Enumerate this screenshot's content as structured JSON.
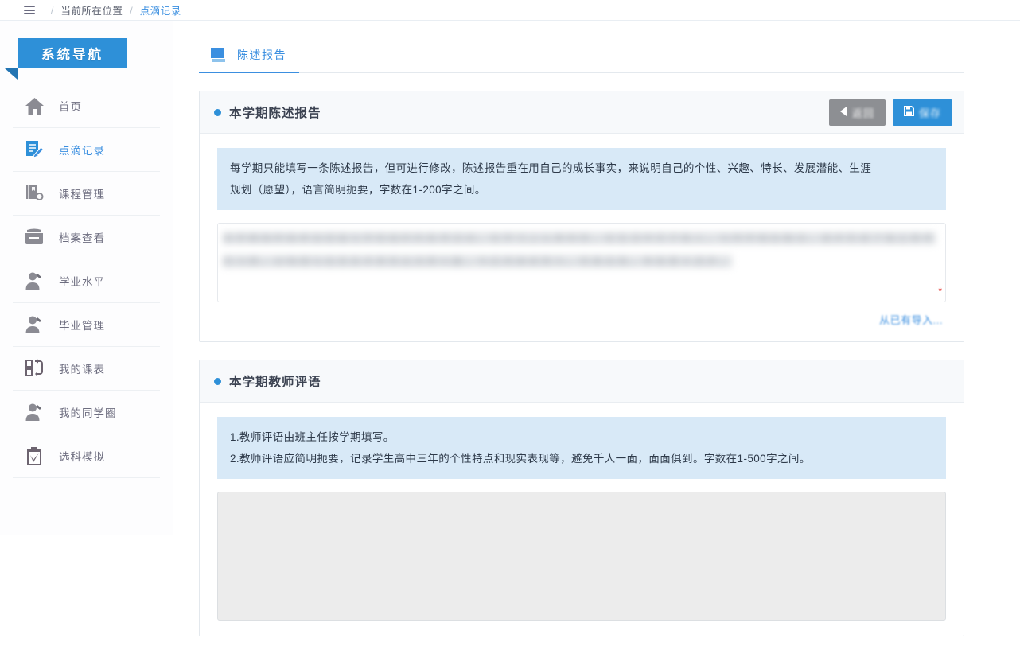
{
  "breadcrumb": {
    "menu_icon": "hamburger-icon",
    "current_label": "当前所在位置",
    "separator": "/",
    "page_label": "点滴记录"
  },
  "sidebar": {
    "banner_title": "系统导航",
    "items": [
      {
        "label": "首页",
        "icon": "home-icon",
        "active": false
      },
      {
        "label": "点滴记录",
        "icon": "note-edit-icon",
        "active": true
      },
      {
        "label": "课程管理",
        "icon": "book-settings-icon",
        "active": false
      },
      {
        "label": "档案查看",
        "icon": "archive-box-icon",
        "active": false
      },
      {
        "label": "学业水平",
        "icon": "user-icon",
        "active": false
      },
      {
        "label": "毕业管理",
        "icon": "user-icon",
        "active": false
      },
      {
        "label": "我的课表",
        "icon": "schedule-swap-icon",
        "active": false
      },
      {
        "label": "我的同学圈",
        "icon": "user-icon",
        "active": false
      },
      {
        "label": "选科模拟",
        "icon": "clipboard-check-icon",
        "active": false
      }
    ]
  },
  "main": {
    "tabs": [
      {
        "label": "陈述报告",
        "icon": "document-tab-icon",
        "active": true
      }
    ],
    "report_panel": {
      "title": "本学期陈述报告",
      "bullet_color": "#2e90d8",
      "buttons": [
        {
          "name": "back",
          "label": "返回",
          "icon": "chevron-left-icon",
          "color": "#8d8f93"
        },
        {
          "name": "save",
          "label": "保存",
          "icon": "save-disk-icon",
          "color": "#2e90d8"
        }
      ],
      "notice_lines": [
        "每学期只能填写一条陈述报告，但可进行修改，陈述报告重在用自己的成长事实，来说明自己的个性、兴趣、特长、发展潜能、生涯",
        "规划（愿望），语言简明扼要，字数在1-200字之间。"
      ],
      "report_text": "本学期我积极参加班级与学校组织的各项活动，在学习上认真刻苦，在生活中乐于助人，与同学相处融洽，逐步形成了独立思考的习惯，对物理与信息技术表现出浓厚兴趣，今后将继续努力，完善自我，争取更大进步。",
      "import_link": "从已有导入...",
      "required_mark": "*"
    },
    "comment_panel": {
      "title": "本学期教师评语",
      "bullet_color": "#2e90d8",
      "notice_lines": [
        "1.教师评语由班主任按学期填写。",
        "2.教师评语应简明扼要，记录学生高中三年的个性特点和现实表现等，避免千人一面，面面俱到。字数在1-500字之间。"
      ],
      "textarea_value": "",
      "textarea_placeholder": ""
    }
  },
  "theme": {
    "accent": "#2e90d8",
    "link": "#3b8fe0",
    "notice_bg": "#d8e9f7",
    "panel_head_bg": "#f7f9fb",
    "gray_button": "#8d8f93"
  }
}
